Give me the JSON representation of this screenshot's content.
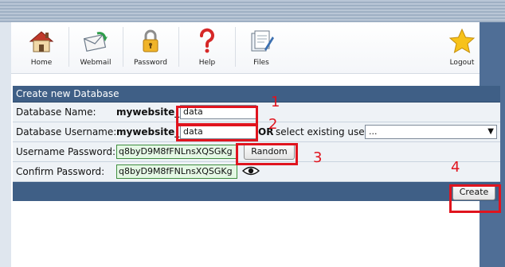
{
  "toolbar": {
    "items": [
      {
        "label": "Home",
        "icon": "home-icon"
      },
      {
        "label": "Webmail",
        "icon": "webmail-icon"
      },
      {
        "label": "Password",
        "icon": "lock-icon"
      },
      {
        "label": "Help",
        "icon": "help-icon"
      },
      {
        "label": "Files",
        "icon": "files-icon"
      },
      {
        "label": "Logout",
        "icon": "star-icon"
      }
    ]
  },
  "form": {
    "title": "Create new Database",
    "db_name_label": "Database Name:",
    "db_prefix": "mywebsite_",
    "db_name_value": "data",
    "db_user_label": "Database Username:",
    "user_prefix": "mywebsite_",
    "db_user_value": "data",
    "or_text": "OR",
    "select_existing_text": "select existing user",
    "existing_user_selected": "...",
    "user_password_label": "Username Password:",
    "user_password_value": "q8byD9M8fFNLnsXQSGKg",
    "random_button": "Random",
    "confirm_password_label": "Confirm Password:",
    "confirm_password_value": "q8byD9M8fFNLnsXQSGKg",
    "create_button": "Create"
  },
  "annotations": {
    "step1": "1",
    "step2": "2",
    "step3": "3",
    "step4": "4",
    "color": "#e0141e"
  },
  "colors": {
    "header_blue": "#3f5f86",
    "row_bg": "#eef2f6",
    "password_field_bg": "#e4f7e4"
  }
}
